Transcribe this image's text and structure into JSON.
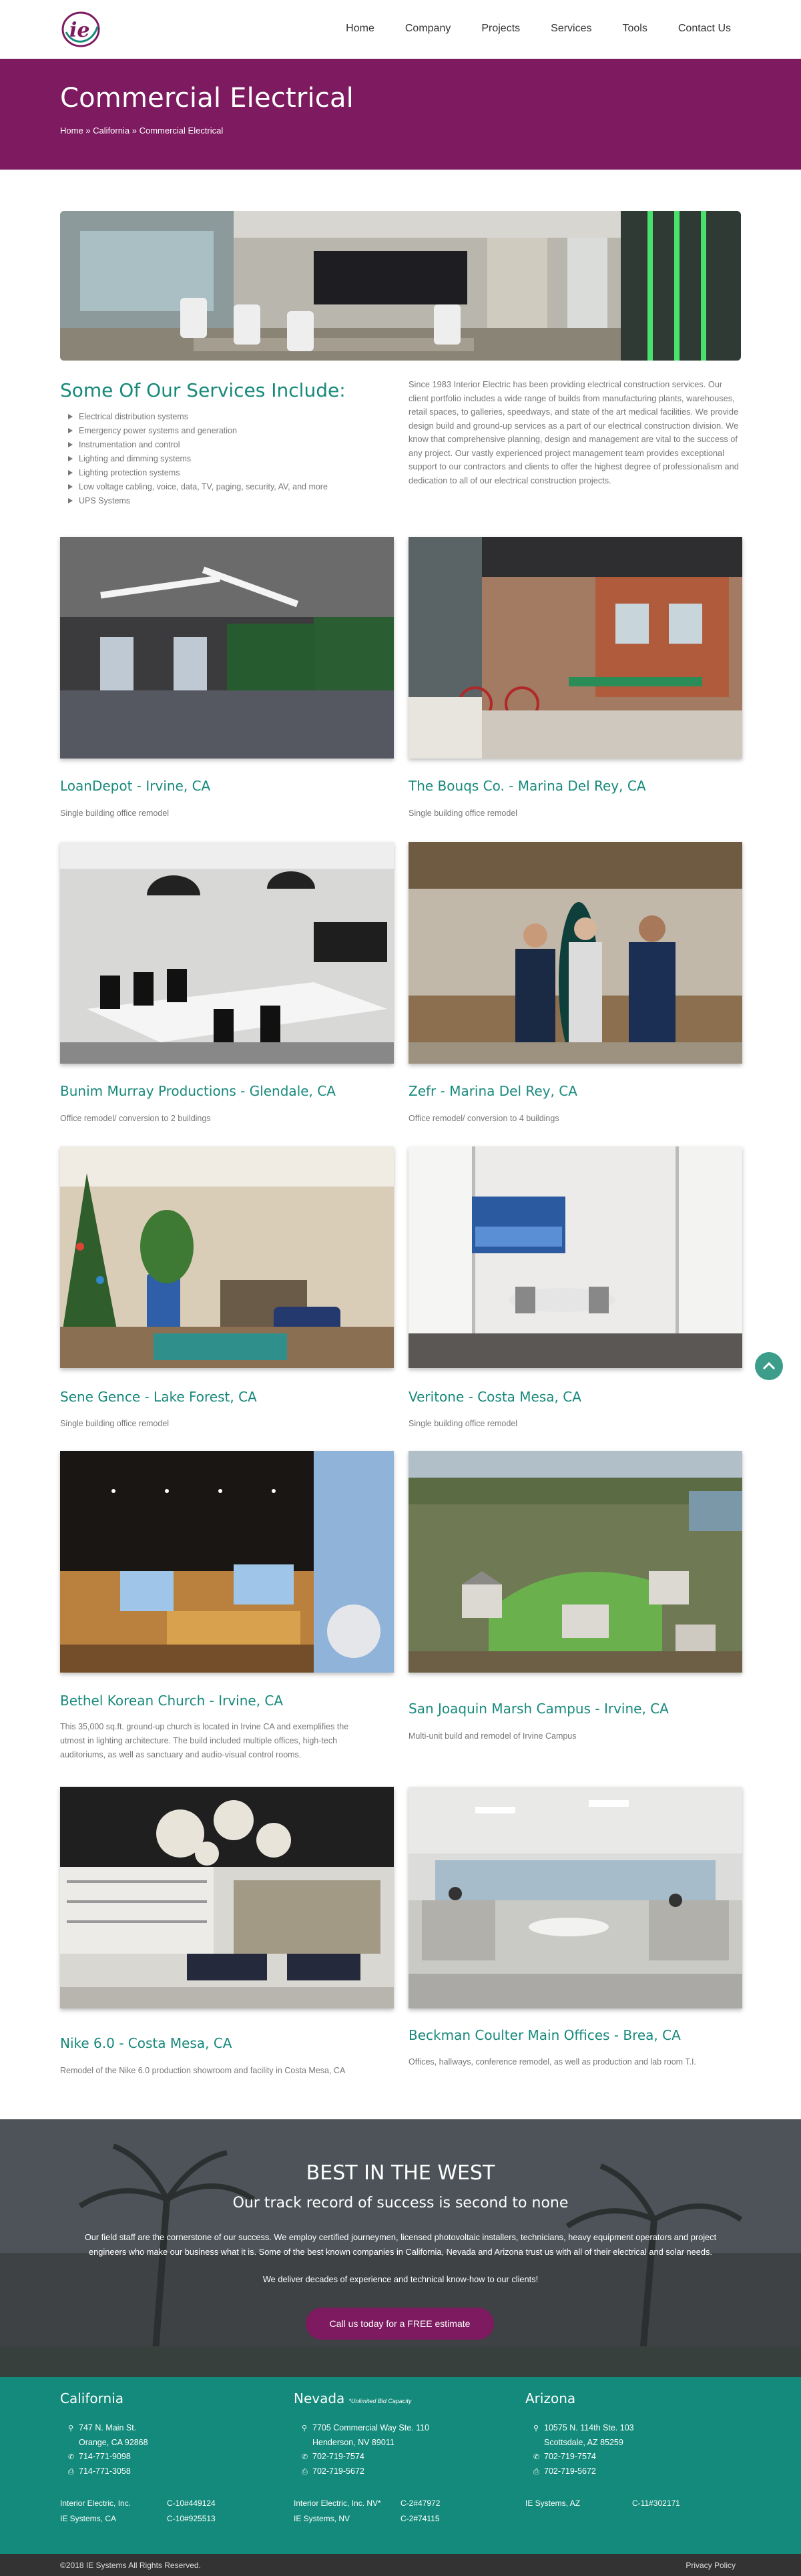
{
  "brand": {
    "logo_alt": "IE logo",
    "colors": {
      "primary": "#7d1a60",
      "accent": "#17897b",
      "footer": "#138a7b"
    }
  },
  "nav": {
    "items": [
      "Home",
      "Company",
      "Projects",
      "Services",
      "Tools",
      "Contact Us"
    ]
  },
  "hero": {
    "title": "Commercial Electrical",
    "breadcrumb": [
      "Home",
      "California",
      "Commercial Electrical"
    ],
    "separator": "»"
  },
  "services": {
    "title": "Some Of Our Services Include:",
    "items": [
      "Electrical distribution systems",
      "Emergency power systems and generation",
      "Instrumentation and control",
      "Lighting and dimming systems",
      "Lighting protection systems",
      "Low voltage cabling, voice, data, TV, paging, security, AV, and more",
      "UPS Systems"
    ],
    "about": "Since 1983 Interior Electric has been providing electrical construction services. Our client portfolio includes a wide range of builds from manufacturing plants, warehouses, retail spaces, to galleries, speedways, and state of the art medical facilities. We provide design build and ground-up services as a part of our electrical construction division. We know that comprehensive planning, design and management are vital to the success of any project. Our vastly experienced project management team provides exceptional support to our contractors and clients to offer the highest degree of professionalism and dedication to all of our electrical construction projects."
  },
  "projects": [
    {
      "title": "LoanDepot - Irvine, CA",
      "desc": "Single building office remodel"
    },
    {
      "title": "The Bouqs Co. - Marina Del Rey, CA",
      "desc": "Single building office remodel"
    },
    {
      "title": "Bunim Murray Productions - Glendale, CA",
      "desc": "Office remodel/ conversion to 2 buildings"
    },
    {
      "title": "Zefr - Marina Del Rey, CA",
      "desc": "Office remodel/ conversion to 4 buildings"
    },
    {
      "title": "Sene Gence - Lake Forest, CA",
      "desc": "Single building office remodel"
    },
    {
      "title": "Veritone - Costa Mesa, CA",
      "desc": "Single building office remodel"
    },
    {
      "title": "Bethel Korean Church - Irvine, CA",
      "desc": "This 35,000 sq.ft. ground-up church is located in Irvine CA and exemplifies the utmost in lighting architecture. The build included multiple offices, high-tech auditoriums, as well as sanctuary and audio-visual control rooms."
    },
    {
      "title": "San Joaquin Marsh Campus - Irvine, CA",
      "desc": "Multi-unit build and remodel of Irvine Campus"
    },
    {
      "title": "Nike 6.0 - Costa Mesa, CA",
      "desc": "Remodel of the Nike 6.0 production showroom and facility in Costa Mesa, CA"
    },
    {
      "title": "Beckman Coulter Main Offices - Brea, CA",
      "desc": "Offices, hallways, conference remodel, as well as production and lab room T.I."
    }
  ],
  "cta": {
    "title": "BEST IN THE WEST",
    "subtitle": "Our track record of success is second to none",
    "body": "Our field staff are the cornerstone of our success. We employ certified journeymen, licensed photovoltaic installers, technicians, heavy equipment operators and project engineers who make our business what it is. Some of the best known companies in California, Nevada and Arizona trust us with all of their electrical and solar needs.",
    "sub": "We deliver decades of experience and technical know-how to our clients!",
    "button": "Call us today for a FREE estimate"
  },
  "footer": {
    "california": {
      "title": "California",
      "address1": "747 N. Main St.",
      "address2": "Orange, CA 92868",
      "phone": "714-771-9098",
      "fax": "714-771-3058",
      "lic": [
        [
          "Interior Electric, Inc.",
          "C-10#449124"
        ],
        [
          "IE Systems, CA",
          "C-10#925513"
        ]
      ]
    },
    "nevada": {
      "title": "Nevada",
      "note": "*Unlimited Bid Capacity",
      "address1": "7705 Commercial Way Ste. 110",
      "address2": "Henderson, NV 89011",
      "phone": "702-719-7574",
      "fax": "702-719-5672",
      "lic": [
        [
          "Interior Electric, Inc. NV*",
          "C-2#47972"
        ],
        [
          "IE Systems, NV",
          "C-2#74115"
        ]
      ]
    },
    "arizona": {
      "title": "Arizona",
      "address1": "10575 N. 114th Ste. 103",
      "address2": "Scottsdale, AZ 85259",
      "phone": "702-719-7574",
      "fax": "702-719-5672",
      "lic": [
        [
          "IE Systems, AZ",
          "C-11#302171"
        ]
      ]
    },
    "icons": {
      "address": "map-pin-icon",
      "phone": "phone-icon",
      "fax": "fax-icon"
    },
    "copyright": "©2018 IE Systems All Rights Reserved.",
    "privacy": "Privacy Policy"
  }
}
